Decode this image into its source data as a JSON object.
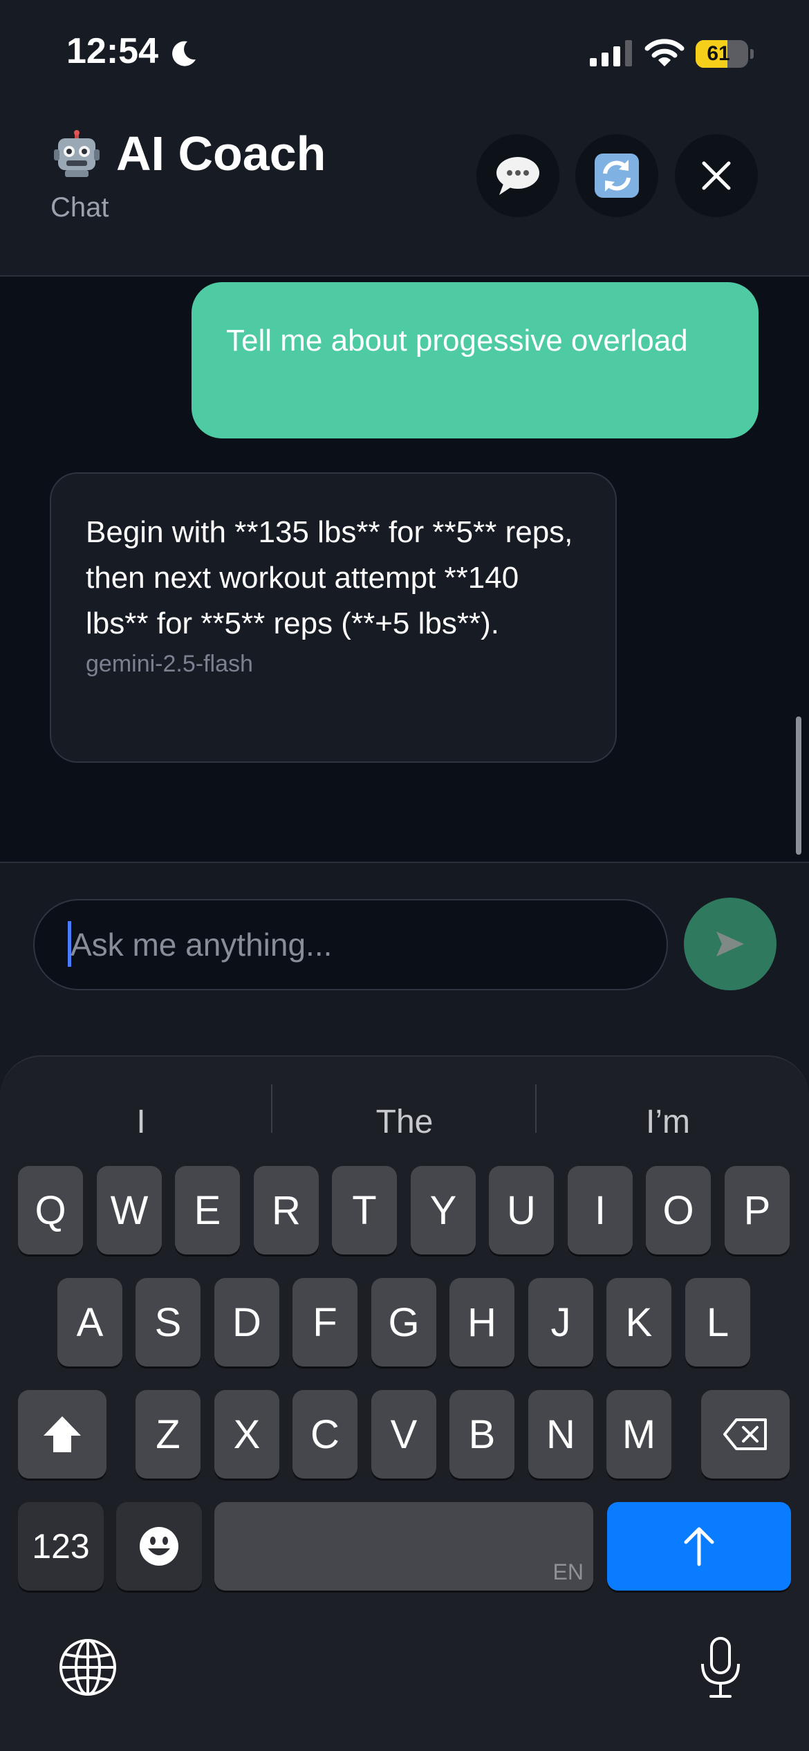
{
  "status_bar": {
    "time": "12:54",
    "battery_percent": 61,
    "battery_label": "61",
    "icons": [
      "moon-icon",
      "cellular-signal-icon",
      "wifi-icon",
      "battery-icon"
    ]
  },
  "header": {
    "icon": "robot-emoji-icon",
    "title": "AI Coach",
    "subtitle": "Chat",
    "buttons": [
      "chat-bubble-icon",
      "refresh-icon",
      "close-icon"
    ]
  },
  "messages": [
    {
      "role": "user",
      "text": "Tell me about progessive overload"
    },
    {
      "role": "assistant",
      "text": "Begin with **135 lbs** for **5** reps, then next workout attempt **140 lbs** for **5** reps (**+5 lbs**).",
      "model": "gemini-2.5-flash"
    }
  ],
  "input": {
    "placeholder": "Ask me anything...",
    "value": ""
  },
  "keyboard": {
    "suggestions": [
      "I",
      "The",
      "I’m"
    ],
    "row1": [
      "Q",
      "W",
      "E",
      "R",
      "T",
      "Y",
      "U",
      "I",
      "O",
      "P"
    ],
    "row2": [
      "A",
      "S",
      "D",
      "F",
      "G",
      "H",
      "J",
      "K",
      "L"
    ],
    "row3": [
      "Z",
      "X",
      "C",
      "V",
      "B",
      "N",
      "M"
    ],
    "numbers_label": "123",
    "space_language": "EN",
    "icons": [
      "shift-icon",
      "backspace-icon",
      "emoji-icon",
      "return-arrow-icon",
      "globe-icon",
      "microphone-icon"
    ]
  },
  "colors": {
    "user_bubble": "#4fcba4",
    "send_button": "#2f7a5f",
    "return_key": "#0a7cff",
    "battery": "#f5cf1a"
  }
}
